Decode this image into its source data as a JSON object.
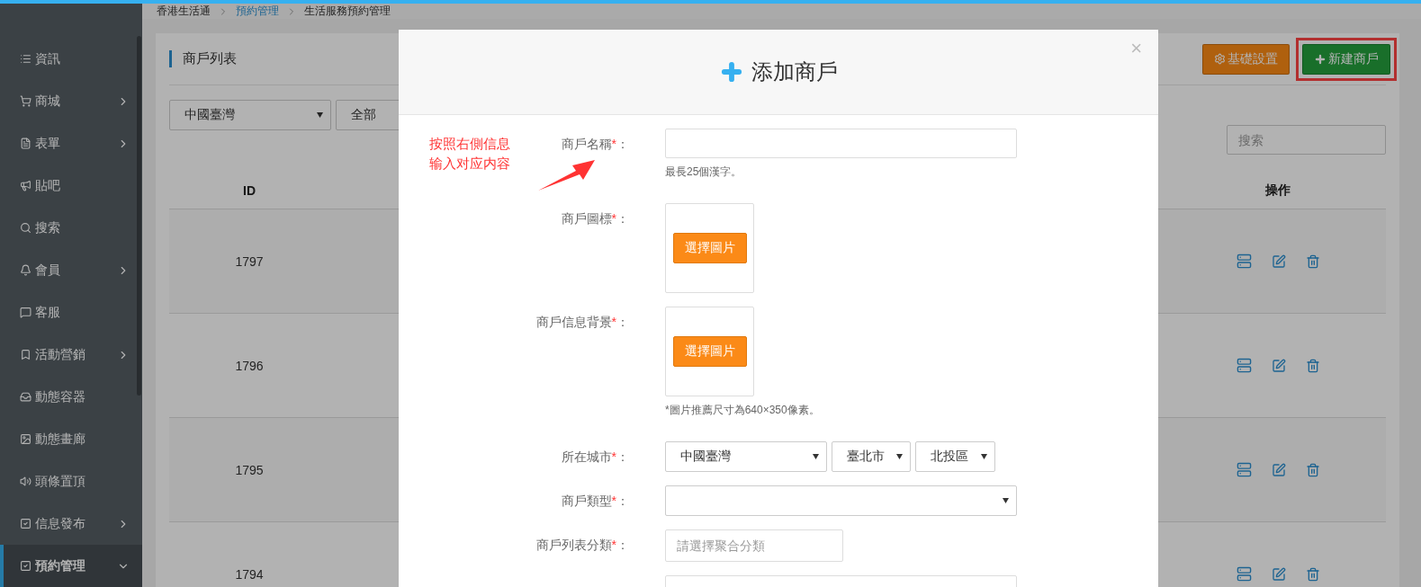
{
  "breadcrumb": [
    {
      "label": "香港生活通",
      "link": false
    },
    {
      "label": "預約管理",
      "link": true
    },
    {
      "label": "生活服務預約管理",
      "link": false
    }
  ],
  "sidebar": {
    "items": [
      {
        "label": "資訊",
        "expandable": false,
        "selected": false
      },
      {
        "label": "商城",
        "expandable": true,
        "selected": false
      },
      {
        "label": "表單",
        "expandable": true,
        "selected": false
      },
      {
        "label": "貼吧",
        "expandable": false,
        "selected": false
      },
      {
        "label": "搜索",
        "expandable": false,
        "selected": false
      },
      {
        "label": "會員",
        "expandable": true,
        "selected": false
      },
      {
        "label": "客服",
        "expandable": false,
        "selected": false
      },
      {
        "label": "活動營銷",
        "expandable": true,
        "selected": false
      },
      {
        "label": "動態容器",
        "expandable": false,
        "selected": false
      },
      {
        "label": "動態畫廊",
        "expandable": false,
        "selected": false
      },
      {
        "label": "頭條置頂",
        "expandable": false,
        "selected": false
      },
      {
        "label": "信息發布",
        "expandable": true,
        "selected": false
      },
      {
        "label": "預約管理",
        "expandable": true,
        "selected": true
      }
    ]
  },
  "panel": {
    "title": "商戶列表",
    "buttons": [
      {
        "label": "基礎設置",
        "kind": "settings",
        "highlighted": false
      },
      {
        "label": "新建商戶",
        "kind": "create",
        "highlighted": true
      }
    ],
    "filters": [
      {
        "value": "中國臺灣"
      },
      {
        "value": "全部"
      }
    ],
    "search": {
      "placeholder": "搜索"
    },
    "table": {
      "columns": [
        "ID",
        "操作"
      ],
      "rows": [
        {
          "id": "1797"
        },
        {
          "id": "1796"
        },
        {
          "id": "1795"
        },
        {
          "id": "1794"
        }
      ]
    }
  },
  "modal": {
    "title": "添加商戶",
    "close": "×",
    "annotation": [
      "按照右側信息",
      "输入对应内容"
    ],
    "fields": [
      {
        "kind": "text",
        "label": "商戶名稱",
        "mark": "*",
        "suffix": "：",
        "hint": "最長25個漢字。"
      },
      {
        "kind": "image",
        "label": "商戶圖標",
        "mark": "*",
        "suffix": "：",
        "button": "選擇圖片"
      },
      {
        "kind": "image",
        "label": "商戶信息背景",
        "mark": "*",
        "suffix": "：",
        "button": "選擇圖片",
        "hint": "*圖片推薦尺寸為640×350像素。"
      },
      {
        "kind": "selects",
        "label": "所在城市",
        "mark": "*",
        "suffix": "：",
        "options": [
          "中國臺灣",
          "臺北市",
          "北投區"
        ]
      },
      {
        "kind": "select",
        "label": "商戶類型",
        "mark": "*",
        "suffix": "："
      },
      {
        "kind": "short",
        "label": "商戶列表分類",
        "mark": "*",
        "suffix": "：",
        "placeholder": "請選擇聚合分類"
      },
      {
        "kind": "text"
      }
    ]
  }
}
